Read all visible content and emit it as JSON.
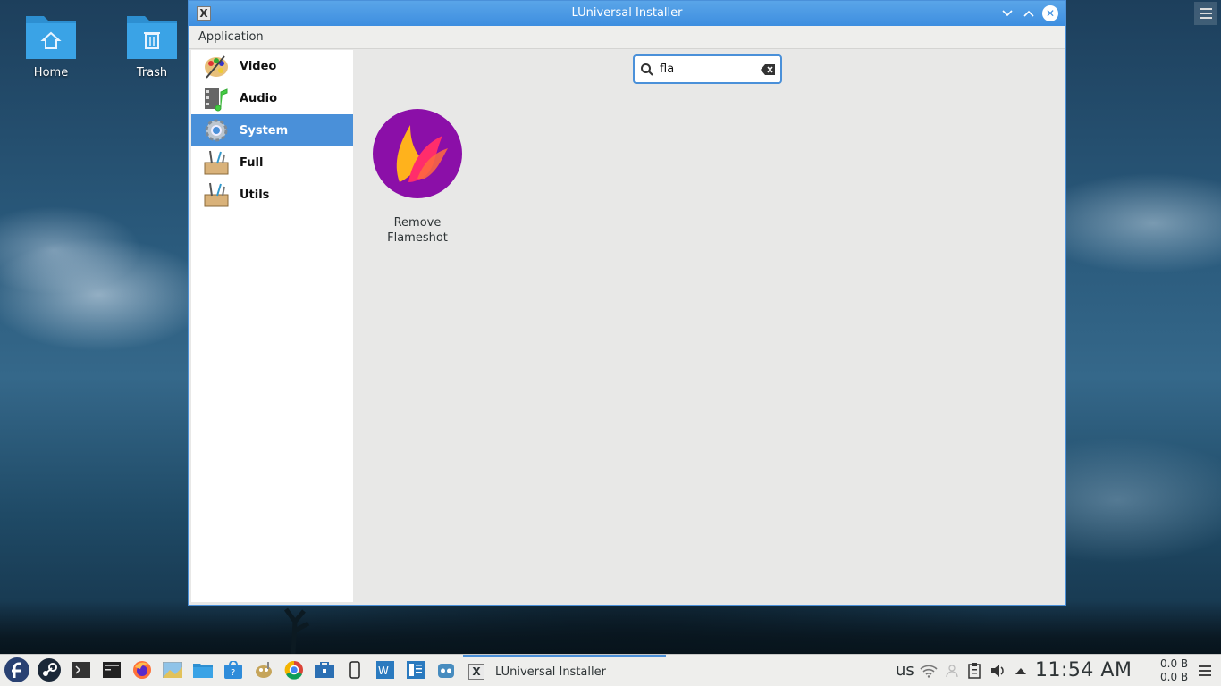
{
  "desktop": {
    "icons": [
      {
        "label": "Home"
      },
      {
        "label": "Trash"
      }
    ]
  },
  "window": {
    "title": "LUniversal Installer",
    "menu": [
      "Application"
    ],
    "sidebar": {
      "items": [
        {
          "label": "Video",
          "icon": "palette-icon",
          "active": false
        },
        {
          "label": "Audio",
          "icon": "multimedia-icon",
          "active": false
        },
        {
          "label": "System",
          "icon": "gear-icon",
          "active": true
        },
        {
          "label": "Full",
          "icon": "toolbox-icon",
          "active": false
        },
        {
          "label": "Utils",
          "icon": "toolbox-icon",
          "active": false
        }
      ]
    },
    "search": {
      "value": "fla"
    },
    "results": [
      {
        "label_line1": "Remove",
        "label_line2": "Flameshot",
        "icon": "flameshot-icon"
      }
    ]
  },
  "taskbar": {
    "task_label": "LUniversal Installer",
    "keyboard_layout": "us",
    "clock": "11:54 AM",
    "net_up": "0.0 B",
    "net_down": "0.0 B"
  },
  "colors": {
    "accent": "#4a90d9",
    "flameshot_bg": "#8b0fa8"
  }
}
